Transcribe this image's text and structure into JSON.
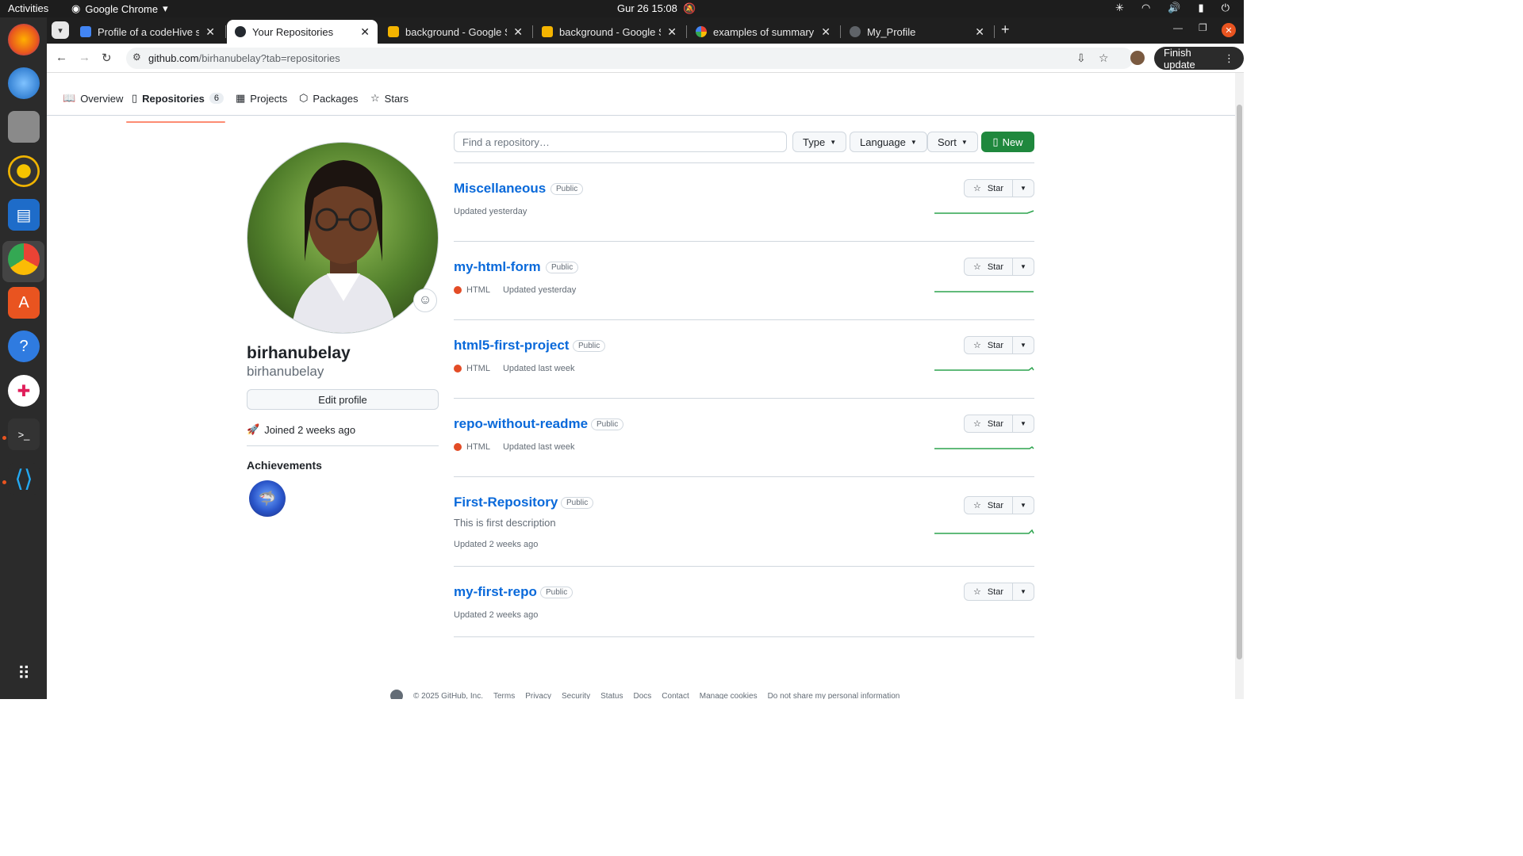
{
  "system": {
    "activities": "Activities",
    "app_name": "Google Chrome",
    "clock": "Gur 26  15:08"
  },
  "browser": {
    "tabs": [
      {
        "title": "Profile of a codeHive stu",
        "favicon_color": "#4285f4"
      },
      {
        "title": "Your Repositories",
        "favicon_color": "#24292f"
      },
      {
        "title": "background - Google Slic",
        "favicon_color": "#f4b400"
      },
      {
        "title": "background - Google Slic",
        "favicon_color": "#f4b400"
      },
      {
        "title": "examples of summary of",
        "favicon_color": "#ffffff"
      },
      {
        "title": "My_Profile",
        "favicon_color": "#5f6368"
      }
    ],
    "url_host": "github.com",
    "url_path": "/birhanubelay?tab=repositories",
    "finish_update": "Finish update"
  },
  "nav": {
    "overview": "Overview",
    "repositories": "Repositories",
    "repo_count": "6",
    "projects": "Projects",
    "packages": "Packages",
    "stars": "Stars"
  },
  "profile": {
    "name": "birhanubelay",
    "login": "birhanubelay",
    "edit_profile": "Edit profile",
    "joined": "Joined 2 weeks ago",
    "achievements_title": "Achievements"
  },
  "toolbar": {
    "search_placeholder": "Find a repository…",
    "type": "Type",
    "language": "Language",
    "sort": "Sort",
    "new": "New"
  },
  "repos": [
    {
      "name": "Miscellaneous",
      "visibility": "Public",
      "description": "",
      "language": "",
      "updated": "Updated yesterday"
    },
    {
      "name": "my-html-form",
      "visibility": "Public",
      "description": "",
      "language": "HTML",
      "updated": "Updated yesterday"
    },
    {
      "name": "html5-first-project",
      "visibility": "Public",
      "description": "",
      "language": "HTML",
      "updated": "Updated last week"
    },
    {
      "name": "repo-without-readme",
      "visibility": "Public",
      "description": "",
      "language": "HTML",
      "updated": "Updated last week"
    },
    {
      "name": "First-Repository",
      "visibility": "Public",
      "description": "This is first description",
      "language": "",
      "updated": "Updated 2 weeks ago"
    },
    {
      "name": "my-first-repo",
      "visibility": "Public",
      "description": "",
      "language": "",
      "updated": "Updated 2 weeks ago"
    }
  ],
  "star_label": "Star",
  "footer": {
    "copyright": "© 2025 GitHub, Inc.",
    "links": [
      "Terms",
      "Privacy",
      "Security",
      "Status",
      "Docs",
      "Contact",
      "Manage cookies",
      "Do not share my personal information"
    ]
  },
  "colors": {
    "link": "#0969da",
    "html_lang": "#e34c26",
    "new_button": "#1f883d",
    "tab_underline": "#fd8c73",
    "sparkline": "#2da44e"
  }
}
